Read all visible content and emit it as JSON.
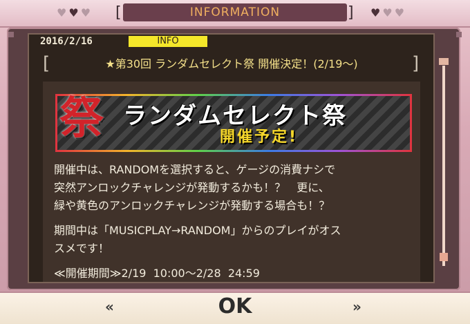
{
  "title": "INFORMATION",
  "info": {
    "date": "2016/2/16",
    "tag": "INFO",
    "headline": "★第30回 ランダムセレクト祭 開催決定！(2/19～)"
  },
  "banner": {
    "kanji": "祭",
    "title": "ランダムセレクト",
    "title_end": "祭",
    "subtitle": "開催予定!"
  },
  "body": {
    "line1": "開催中は、RANDOMを選択すると、ゲージの消費ナシで",
    "line2": "突然アンロックチャレンジが発動するかも！？　更に、",
    "line3": "緑や黄色のアンロックチャレンジが発動する場合も！？",
    "line4": "期間中は「MUSICPLAY→RANDOM」からのプレイがオス",
    "line5": "スメです！",
    "line6": "≪開催期間≫2/19  10:00～2/28  24:59"
  },
  "buttons": {
    "ok": "OK",
    "prev": "«",
    "next": "»"
  }
}
